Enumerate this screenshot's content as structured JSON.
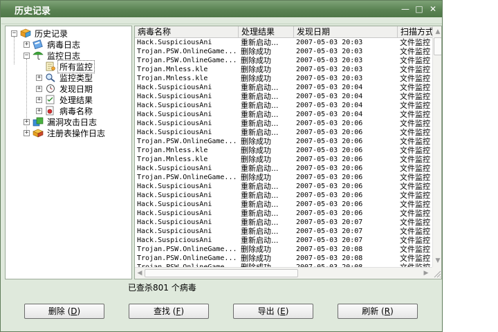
{
  "window": {
    "title": "历史记录"
  },
  "tree": {
    "root": "历史记录",
    "items": [
      {
        "label": "病毒日志"
      },
      {
        "label": "监控日志"
      },
      {
        "label": "所有监控"
      },
      {
        "label": "监控类型"
      },
      {
        "label": "发现日期"
      },
      {
        "label": "处理结果"
      },
      {
        "label": "病毒名称"
      },
      {
        "label": "漏洞攻击日志"
      },
      {
        "label": "注册表操作日志"
      }
    ]
  },
  "grid": {
    "columns": [
      "病毒名称",
      "处理结果",
      "发现日期",
      "扫描方式"
    ],
    "rows": [
      [
        "Hack.SuspiciousAni",
        "重新启动...",
        "2007-05-03 20:03",
        "文件监控"
      ],
      [
        "Trojan.PSW.OnlineGame...",
        "删除成功",
        "2007-05-03 20:03",
        "文件监控"
      ],
      [
        "Trojan.PSW.OnlineGame...",
        "删除成功",
        "2007-05-03 20:03",
        "文件监控"
      ],
      [
        "Trojan.Mnless.kle",
        "删除成功",
        "2007-05-03 20:03",
        "文件监控"
      ],
      [
        "Trojan.Mnless.kle",
        "删除成功",
        "2007-05-03 20:03",
        "文件监控"
      ],
      [
        "Hack.SuspiciousAni",
        "重新启动...",
        "2007-05-03 20:04",
        "文件监控"
      ],
      [
        "Hack.SuspiciousAni",
        "重新启动...",
        "2007-05-03 20:04",
        "文件监控"
      ],
      [
        "Hack.SuspiciousAni",
        "重新启动...",
        "2007-05-03 20:04",
        "文件监控"
      ],
      [
        "Hack.SuspiciousAni",
        "重新启动...",
        "2007-05-03 20:04",
        "文件监控"
      ],
      [
        "Hack.SuspiciousAni",
        "重新启动...",
        "2007-05-03 20:06",
        "文件监控"
      ],
      [
        "Hack.SuspiciousAni",
        "重新启动...",
        "2007-05-03 20:06",
        "文件监控"
      ],
      [
        "Trojan.PSW.OnlineGame...",
        "删除成功",
        "2007-05-03 20:06",
        "文件监控"
      ],
      [
        "Trojan.Mnless.kle",
        "删除成功",
        "2007-05-03 20:06",
        "文件监控"
      ],
      [
        "Trojan.Mnless.kle",
        "删除成功",
        "2007-05-03 20:06",
        "文件监控"
      ],
      [
        "Hack.SuspiciousAni",
        "重新启动...",
        "2007-05-03 20:06",
        "文件监控"
      ],
      [
        "Trojan.PSW.OnlineGame...",
        "删除成功",
        "2007-05-03 20:06",
        "文件监控"
      ],
      [
        "Hack.SuspiciousAni",
        "重新启动...",
        "2007-05-03 20:06",
        "文件监控"
      ],
      [
        "Hack.SuspiciousAni",
        "重新启动...",
        "2007-05-03 20:06",
        "文件监控"
      ],
      [
        "Hack.SuspiciousAni",
        "重新启动...",
        "2007-05-03 20:06",
        "文件监控"
      ],
      [
        "Hack.SuspiciousAni",
        "重新启动...",
        "2007-05-03 20:06",
        "文件监控"
      ],
      [
        "Hack.SuspiciousAni",
        "重新启动...",
        "2007-05-03 20:07",
        "文件监控"
      ],
      [
        "Hack.SuspiciousAni",
        "重新启动...",
        "2007-05-03 20:07",
        "文件监控"
      ],
      [
        "Hack.SuspiciousAni",
        "重新启动...",
        "2007-05-03 20:07",
        "文件监控"
      ],
      [
        "Trojan.PSW.OnlineGame...",
        "删除成功",
        "2007-05-03 20:08",
        "文件监控"
      ],
      [
        "Trojan.PSW.OnlineGame...",
        "删除成功",
        "2007-05-03 20:08",
        "文件监控"
      ],
      [
        "Trojan.PSW.OnlineGame...",
        "删除成功",
        "2007-05-03 20:08",
        "文件监控"
      ]
    ]
  },
  "status": {
    "text": "已查杀801 个病毒"
  },
  "buttons": {
    "delete": {
      "label": "删除",
      "key": "D"
    },
    "find": {
      "label": "查找",
      "key": "F"
    },
    "export": {
      "label": "导出",
      "key": "E"
    },
    "refresh": {
      "label": "刷新",
      "key": "R"
    }
  }
}
